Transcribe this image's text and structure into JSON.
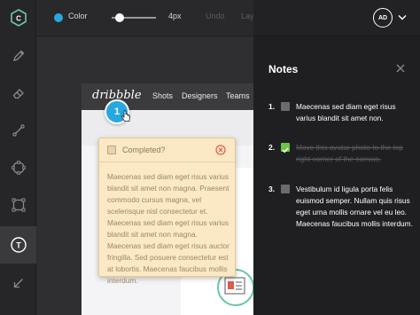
{
  "app": {
    "logo_letter": "C"
  },
  "toolbar": {
    "color_label": "Color",
    "color_value": "#27a8e0",
    "brush_size_label": "4px",
    "undo_label": "Undo",
    "layers_label": "Lay"
  },
  "tools": [
    {
      "name": "pencil-icon"
    },
    {
      "name": "eraser-icon"
    },
    {
      "name": "line-icon"
    },
    {
      "name": "ellipse-icon"
    },
    {
      "name": "rectangle-icon"
    },
    {
      "name": "text-icon",
      "active": true,
      "label": "T"
    },
    {
      "name": "arrow-icon"
    }
  ],
  "canvas": {
    "site": {
      "logo_text": "dribbble",
      "nav": [
        "Shots",
        "Designers",
        "Teams"
      ]
    },
    "marker": {
      "number": "1"
    },
    "note_popover": {
      "completed_label": "Completed?",
      "body": "Maecenas sed diam eget risus varius blandit sit amet non magna. Praesent commodo cursus magna, vel scelerisque nisl consectetur et. Maecenas sed diam eget risus varius blandit sit amet non magna. Maecenas sed diam eget risus auctor fringilla. Sed posuere consectetur est at lobortis. Maecenas faucibus mollis interdum."
    }
  },
  "user": {
    "initials": "AD"
  },
  "notes_panel": {
    "title": "Notes",
    "items": [
      {
        "number": "1.",
        "text": "Maecenas sed diam eget risus varius blandit sit amet non.",
        "completed": false
      },
      {
        "number": "2.",
        "text": "Move this avatar photo to the top right corner of the canvas.",
        "completed": true
      },
      {
        "number": "3.",
        "text": "Vestibulum id ligula porta felis euismod semper. Nullam quis risus eget urna mollis ornare vel eu leo. Maecenas faucibus mollis interdum.",
        "completed": false
      }
    ]
  },
  "colors": {
    "accent": "#27a8e0",
    "done_check": "#6cc644",
    "popover_bg": "#fbe8c4",
    "close_red": "#e05a4f"
  }
}
